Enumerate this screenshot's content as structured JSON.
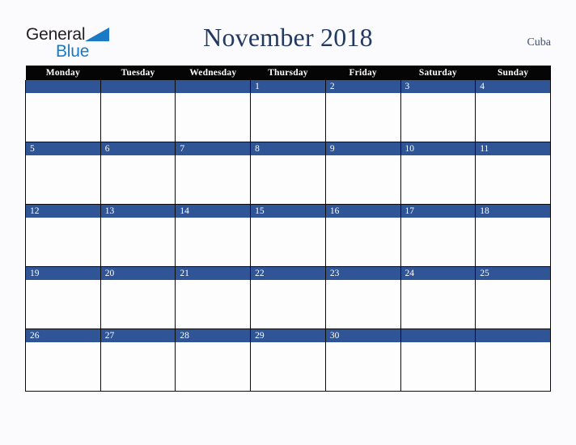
{
  "brand": {
    "name_part1": "General",
    "name_part2": "Blue",
    "triangle_icon": "triangle-icon"
  },
  "header": {
    "title": "November 2018",
    "country": "Cuba"
  },
  "colors": {
    "accent_blue": "#2f5597",
    "header_black": "#050505",
    "title_navy": "#24395f",
    "logo_blue": "#1a7ac4",
    "page_background": "#fbfbfd",
    "cell_background": "#fdfdfd"
  },
  "calendar": {
    "month": "November",
    "year": "2018",
    "weekday_headers": [
      "Monday",
      "Tuesday",
      "Wednesday",
      "Thursday",
      "Friday",
      "Saturday",
      "Sunday"
    ],
    "weeks": [
      [
        {
          "day": ""
        },
        {
          "day": ""
        },
        {
          "day": ""
        },
        {
          "day": "1"
        },
        {
          "day": "2"
        },
        {
          "day": "3"
        },
        {
          "day": "4"
        }
      ],
      [
        {
          "day": "5"
        },
        {
          "day": "6"
        },
        {
          "day": "7"
        },
        {
          "day": "8"
        },
        {
          "day": "9"
        },
        {
          "day": "10"
        },
        {
          "day": "11"
        }
      ],
      [
        {
          "day": "12"
        },
        {
          "day": "13"
        },
        {
          "day": "14"
        },
        {
          "day": "15"
        },
        {
          "day": "16"
        },
        {
          "day": "17"
        },
        {
          "day": "18"
        }
      ],
      [
        {
          "day": "19"
        },
        {
          "day": "20"
        },
        {
          "day": "21"
        },
        {
          "day": "22"
        },
        {
          "day": "23"
        },
        {
          "day": "24"
        },
        {
          "day": "25"
        }
      ],
      [
        {
          "day": "26"
        },
        {
          "day": "27"
        },
        {
          "day": "28"
        },
        {
          "day": "29"
        },
        {
          "day": "30"
        },
        {
          "day": ""
        },
        {
          "day": ""
        }
      ]
    ]
  }
}
